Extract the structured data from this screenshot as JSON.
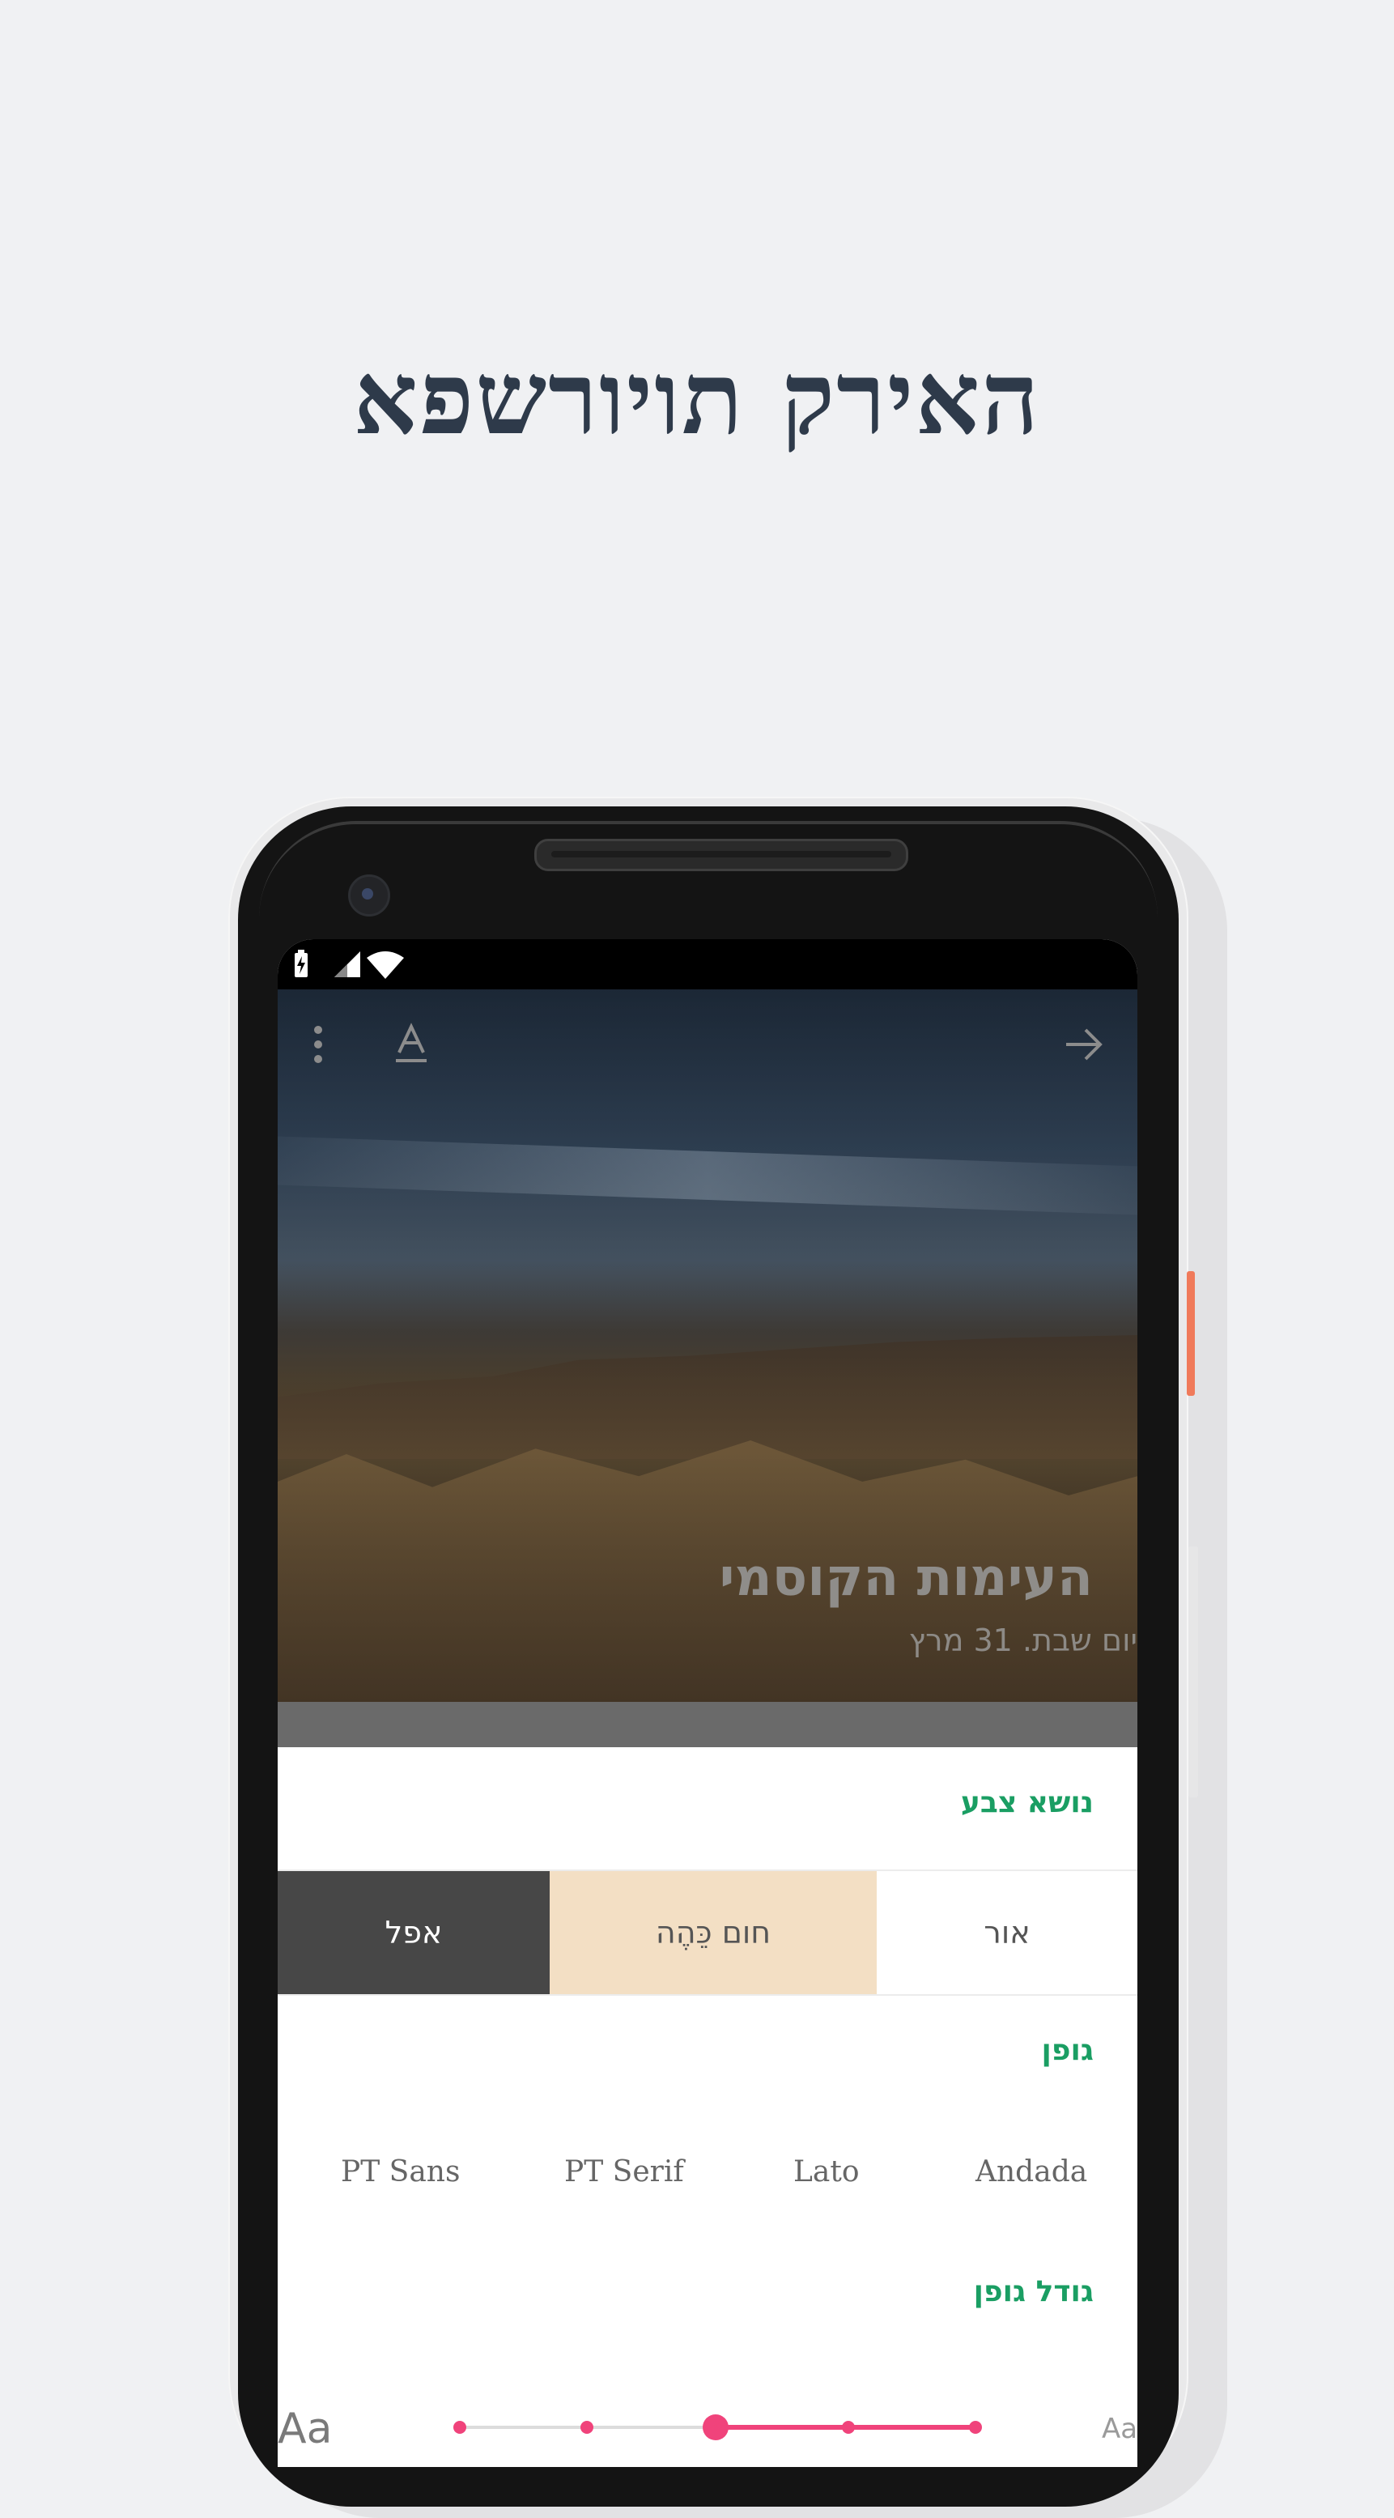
{
  "headline": "האירק תויורשפא",
  "article": {
    "title": "העימות הקוסמי",
    "date": "יום שבת. 31 מרץ"
  },
  "toolbar": {
    "menu_icon": "more-vert-icon",
    "font_icon": "text-format-icon",
    "forward_icon": "arrow-forward-icon"
  },
  "settings": {
    "color_theme_title": "נושא צבע",
    "themes": [
      {
        "label": "אפל",
        "color": "#474747"
      },
      {
        "label": "חום כֵּהֶה",
        "color": "#f3dfc4"
      },
      {
        "label": "אור",
        "color": "#ffffff"
      }
    ],
    "font_title": "גופן",
    "fonts": [
      "PT Sans",
      "PT Serif",
      "Lato",
      "Andada"
    ],
    "font_size_title": "גודל גופן",
    "size_small_label": "Aa",
    "size_large_label": "Aa",
    "font_size_level": 3,
    "font_size_steps": 5
  },
  "colors": {
    "accent_green": "#1a9e63",
    "slider_pink": "#f0437b",
    "background": "#f0f1f3"
  }
}
